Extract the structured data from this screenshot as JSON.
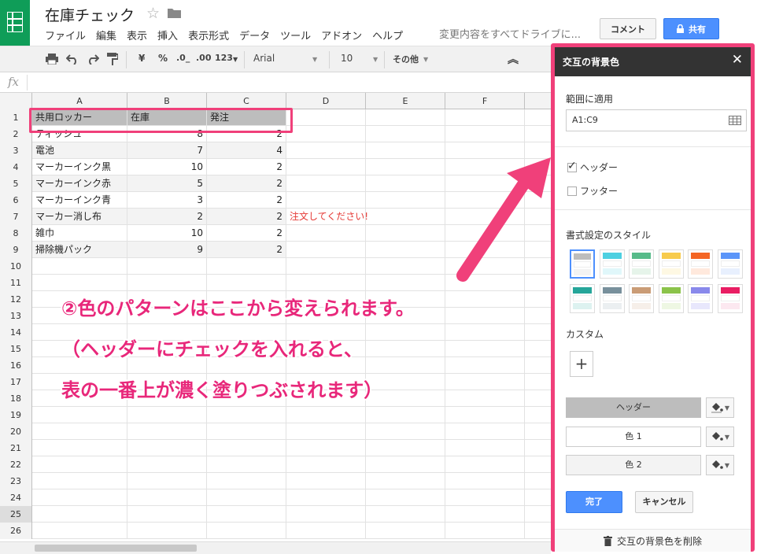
{
  "header": {
    "doc_title": "在庫チェック",
    "menus": [
      "ファイル",
      "編集",
      "表示",
      "挿入",
      "表示形式",
      "データ",
      "ツール",
      "アドオン",
      "ヘルプ"
    ],
    "save_status": "変更内容をすべてドライブに...",
    "comment_label": "コメント",
    "share_label": "共有"
  },
  "toolbar": {
    "currency": "¥",
    "percent": "%",
    "dec_less": ".0_",
    "dec_more": ".00",
    "number_format": "123",
    "font": "Arial",
    "font_size": "10",
    "more": "その他"
  },
  "formula": {
    "fx_label": "fx"
  },
  "grid": {
    "columns": [
      "A",
      "B",
      "C",
      "D",
      "E",
      "F"
    ],
    "rows": [
      {
        "n": "1",
        "a": "共用ロッカー",
        "b": "在庫",
        "c": "発注",
        "d": ""
      },
      {
        "n": "2",
        "a": "ティッシュ",
        "b": "8",
        "c": "2",
        "d": ""
      },
      {
        "n": "3",
        "a": "電池",
        "b": "7",
        "c": "4",
        "d": ""
      },
      {
        "n": "4",
        "a": "マーカーインク黒",
        "b": "10",
        "c": "2",
        "d": ""
      },
      {
        "n": "5",
        "a": "マーカーインク赤",
        "b": "5",
        "c": "2",
        "d": ""
      },
      {
        "n": "6",
        "a": "マーカーインク青",
        "b": "3",
        "c": "2",
        "d": ""
      },
      {
        "n": "7",
        "a": "マーカー消し布",
        "b": "2",
        "c": "2",
        "d": "注文してください!"
      },
      {
        "n": "8",
        "a": "雑巾",
        "b": "10",
        "c": "2",
        "d": ""
      },
      {
        "n": "9",
        "a": "掃除機パック",
        "b": "9",
        "c": "2",
        "d": ""
      },
      {
        "n": "10"
      },
      {
        "n": "11"
      },
      {
        "n": "12"
      },
      {
        "n": "13"
      },
      {
        "n": "14"
      },
      {
        "n": "15"
      },
      {
        "n": "16"
      },
      {
        "n": "17"
      },
      {
        "n": "18"
      },
      {
        "n": "19"
      },
      {
        "n": "20"
      },
      {
        "n": "21"
      },
      {
        "n": "22"
      },
      {
        "n": "23"
      },
      {
        "n": "24"
      },
      {
        "n": "25"
      },
      {
        "n": "26"
      }
    ],
    "active_row": "25"
  },
  "annotation": {
    "line1": "②色のパターンはここから変えられます。",
    "line2": "（ヘッダーにチェックを入れると、",
    "line3": "表の一番上が濃く塗りつぶされます）"
  },
  "panel": {
    "title": "交互の背景色",
    "range_label": "範囲に適用",
    "range_value": "A1:C9",
    "header_checkbox": "ヘッダー",
    "header_checked": true,
    "footer_checkbox": "フッター",
    "footer_checked": false,
    "styles_label": "書式設定のスタイル",
    "custom_label": "カスタム",
    "custom_add": "+",
    "header_color_label": "ヘッダー",
    "color1_label": "色 1",
    "color2_label": "色 2",
    "done_label": "完了",
    "cancel_label": "キャンセル",
    "remove_label": "交互の背景色を削除",
    "styles": [
      {
        "header": "#bdbdbd",
        "band": "#f3f3f3"
      },
      {
        "header": "#4dd0e1",
        "band": "#e0f7fa"
      },
      {
        "header": "#57bb8a",
        "band": "#e6f4ea"
      },
      {
        "header": "#f7cb4d",
        "band": "#fef8e3"
      },
      {
        "header": "#f46524",
        "band": "#ffe9dd"
      },
      {
        "header": "#5b95f9",
        "band": "#e8f0fe"
      },
      {
        "header": "#26a69a",
        "band": "#ddf2f0"
      },
      {
        "header": "#78909c",
        "band": "#ebeff1"
      },
      {
        "header": "#ca9c76",
        "band": "#f6efe9"
      },
      {
        "header": "#8bc34a",
        "band": "#eef7e3"
      },
      {
        "header": "#8989eb",
        "band": "#e8e7fc"
      },
      {
        "header": "#e91d63",
        "band": "#fce8f0"
      }
    ]
  },
  "colors": {
    "sheets_green": "#0f9d58",
    "accent_pink": "#f0407a",
    "blue_button": "#4d90fe",
    "header_gray": "#bdbdbd",
    "band_gray": "#f3f3f3",
    "note_red": "#e53935"
  }
}
